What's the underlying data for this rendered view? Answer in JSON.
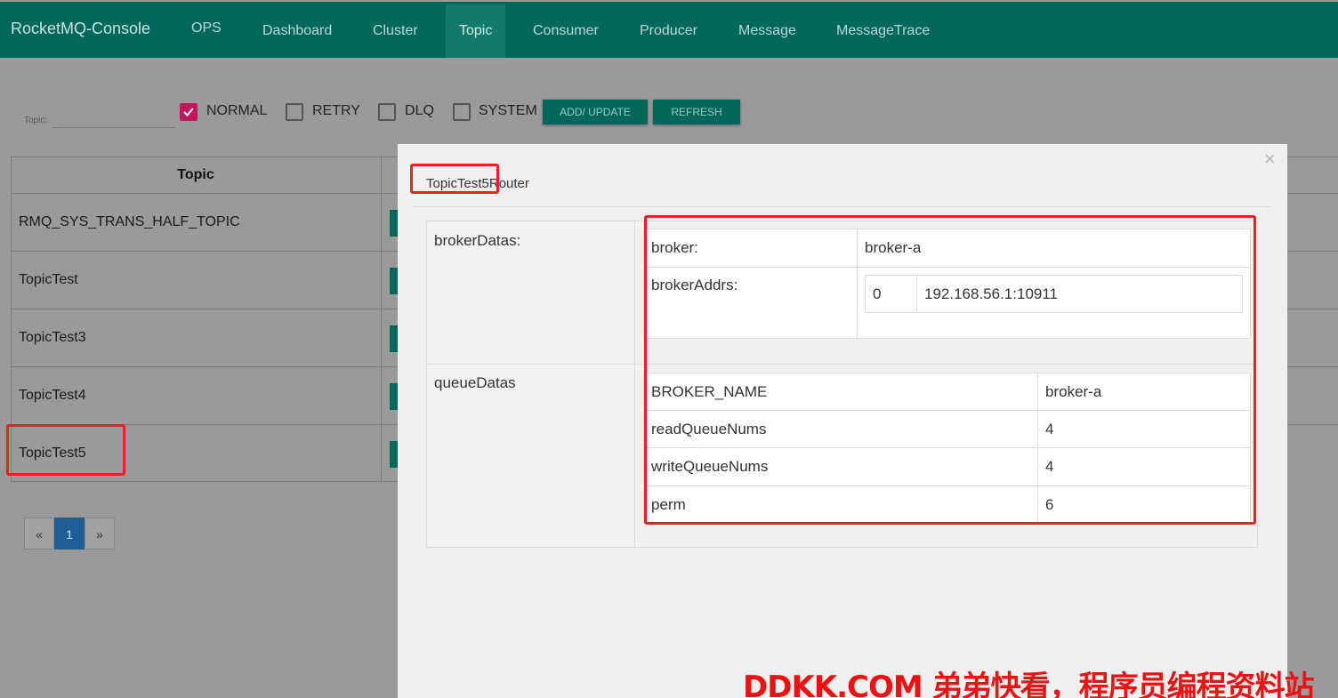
{
  "navbar": {
    "brand": "RocketMQ-Console",
    "items": [
      {
        "label": "OPS"
      },
      {
        "label": "Dashboard"
      },
      {
        "label": "Cluster"
      },
      {
        "label": "Topic"
      },
      {
        "label": "Consumer"
      },
      {
        "label": "Producer"
      },
      {
        "label": "Message"
      },
      {
        "label": "MessageTrace"
      }
    ],
    "active": "Topic"
  },
  "filter": {
    "topic_label": "Topic:",
    "topic_value": "",
    "checkboxes": [
      {
        "label": "NORMAL",
        "checked": true
      },
      {
        "label": "RETRY",
        "checked": false
      },
      {
        "label": "DLQ",
        "checked": false
      },
      {
        "label": "SYSTEM",
        "checked": false
      }
    ],
    "add_update_label": "ADD/ UPDATE",
    "refresh_label": "REFRESH"
  },
  "table": {
    "header": "Topic",
    "rows": [
      "RMQ_SYS_TRANS_HALF_TOPIC",
      "TopicTest",
      "TopicTest3",
      "TopicTest4",
      "TopicTest5"
    ]
  },
  "pagination": {
    "prev": "«",
    "current": "1",
    "next": "»"
  },
  "modal": {
    "close": "×",
    "title": "TopicTest5Router",
    "broker_datas_key": "brokerDatas:",
    "broker_key": "broker:",
    "broker_value": "broker-a",
    "broker_addrs_key": "brokerAddrs:",
    "broker_addrs": [
      {
        "id": "0",
        "addr": "192.168.56.1:10911"
      }
    ],
    "queue_datas_key": "queueDatas",
    "queue_rows": [
      {
        "key": "BROKER_NAME",
        "value": "broker-a"
      },
      {
        "key": "readQueueNums",
        "value": "4"
      },
      {
        "key": "writeQueueNums",
        "value": "4"
      },
      {
        "key": "perm",
        "value": "6"
      }
    ]
  },
  "watermark": "DDKK.COM 弟弟快看，程序员编程资料站",
  "colors": {
    "primary": "#00685a",
    "checkbox": "#c2185b",
    "annotation": "#f01e1e",
    "pager_active": "#1e5f96"
  }
}
